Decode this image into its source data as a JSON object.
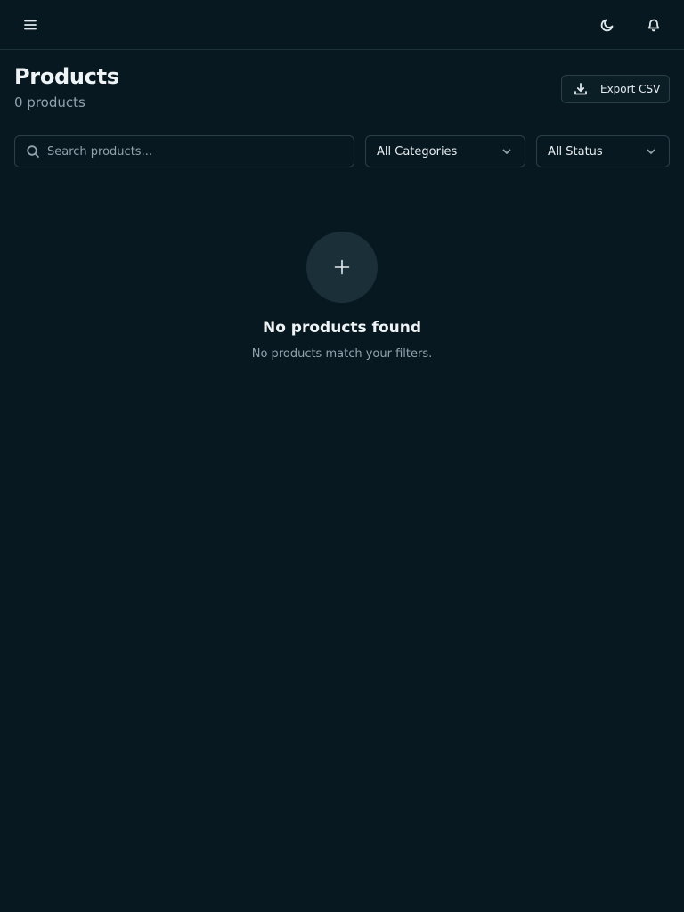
{
  "header": {
    "menu_icon": "hamburger-menu-icon",
    "theme_icon": "moon-icon",
    "notification_icon": "bell-icon"
  },
  "page": {
    "title": "Products",
    "count_text": "0 products",
    "export_label": "Export CSV",
    "export_icon": "download-icon"
  },
  "filters": {
    "search": {
      "placeholder": "Search products...",
      "value": ""
    },
    "category": {
      "selected": "All Categories"
    },
    "status": {
      "selected": "All Status"
    }
  },
  "empty_state": {
    "icon": "plus-icon",
    "title": "No products found",
    "subtitle": "No products match your filters."
  },
  "colors": {
    "background": "#081820",
    "surface": "#1a2f38",
    "border": "#2a3f48",
    "text_primary": "#eef3f5",
    "text_muted": "#8fa3ac"
  }
}
